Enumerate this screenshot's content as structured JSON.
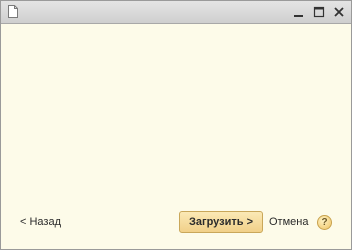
{
  "window": {
    "icon": "document-icon",
    "controls": {
      "minimize": "minimize-icon",
      "maximize": "maximize-icon",
      "close": "close-icon"
    }
  },
  "footer": {
    "back_label": "< Назад",
    "load_label": "Загрузить >",
    "cancel_label": "Отмена",
    "help_label": "?"
  },
  "colors": {
    "content_bg": "#fdfbe9",
    "titlebar_bg": "#d8d8d8",
    "primary_button": "#f4d996"
  }
}
